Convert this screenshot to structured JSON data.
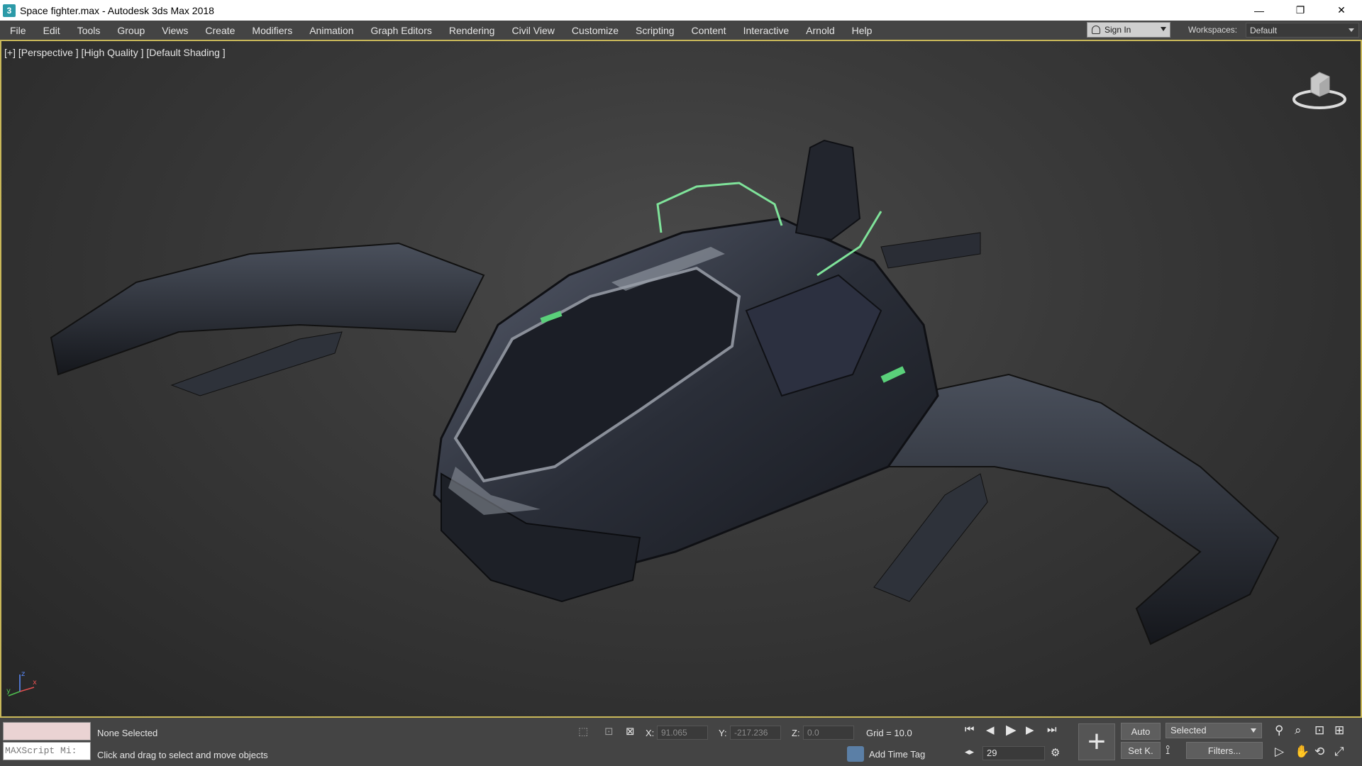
{
  "window": {
    "title": "Space fighter.max - Autodesk 3ds Max 2018",
    "app_icon_glyph": "3",
    "controls": {
      "minimize": "—",
      "restore": "❐",
      "close": "✕"
    }
  },
  "menubar": {
    "items": [
      "File",
      "Edit",
      "Tools",
      "Group",
      "Views",
      "Create",
      "Modifiers",
      "Animation",
      "Graph Editors",
      "Rendering",
      "Civil View",
      "Customize",
      "Scripting",
      "Content",
      "Interactive",
      "Arnold",
      "Help"
    ],
    "signin_label": "Sign In",
    "workspaces_label": "Workspaces:",
    "workspace_value": "Default"
  },
  "viewport": {
    "label": "[+] [Perspective ] [High Quality ] [Default Shading ]",
    "border_color": "#c9b85a",
    "axis": {
      "z": "z",
      "x": "x",
      "y": "y"
    }
  },
  "statusbar": {
    "maxscript_placeholder": "MAXScript Mi:",
    "selection_status": "None Selected",
    "prompt": "Click and drag to select and move objects",
    "coords": {
      "x_label": "X:",
      "x_value": "91.065",
      "y_label": "Y:",
      "y_value": "-217.236",
      "z_label": "Z:",
      "z_value": "0.0"
    },
    "grid": "Grid = 10.0",
    "add_time_tag": "Add Time Tag",
    "current_frame": "29",
    "auto_key": "Auto",
    "set_key": "Set K.",
    "key_filter_selected": "Selected",
    "filters": "Filters..."
  },
  "icons": {
    "first_frame": "⏮",
    "prev_frame": "◀",
    "play": "▶",
    "next_frame": "▶",
    "last_frame": "⏭",
    "zoom": "⚲",
    "pan": "✋",
    "plus": "+",
    "lock": "🔒"
  }
}
